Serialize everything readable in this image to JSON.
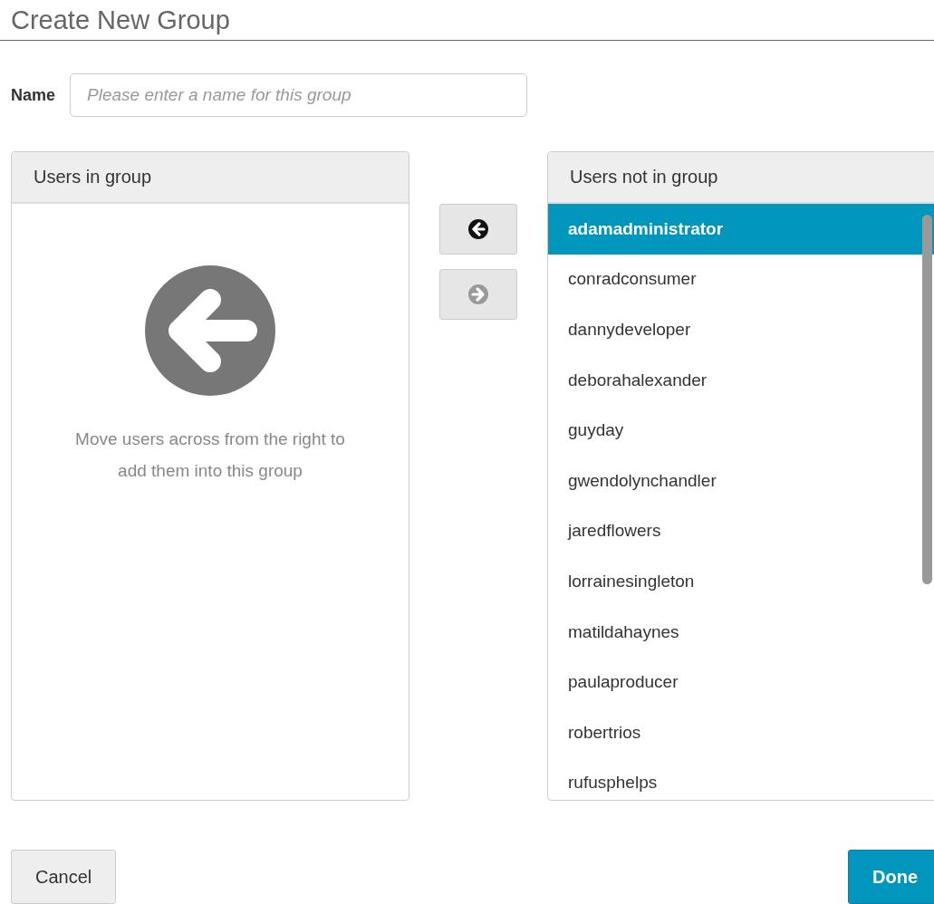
{
  "title": "Create New Group",
  "name_field": {
    "label": "Name",
    "placeholder": "Please enter a name for this group"
  },
  "users_in_group": {
    "header": "Users in group",
    "empty_message": "Move users across from the right to add them into this group"
  },
  "transfer_buttons": [
    {
      "kind": "left",
      "disabled": false
    },
    {
      "kind": "right",
      "disabled": true
    }
  ],
  "users_not_in_group": {
    "header": "Users not in group",
    "users": [
      {
        "name": "adamadministrator",
        "selected": true
      },
      {
        "name": "conradconsumer",
        "selected": false
      },
      {
        "name": "dannydeveloper",
        "selected": false
      },
      {
        "name": "deborahalexander",
        "selected": false
      },
      {
        "name": "guyday",
        "selected": false
      },
      {
        "name": "gwendolynchandler",
        "selected": false
      },
      {
        "name": "jaredflowers",
        "selected": false
      },
      {
        "name": "lorrainesingleton",
        "selected": false
      },
      {
        "name": "matildahaynes",
        "selected": false
      },
      {
        "name": "paulaproducer",
        "selected": false
      },
      {
        "name": "robertrios",
        "selected": false
      },
      {
        "name": "rufusphelps",
        "selected": false
      }
    ]
  },
  "buttons": [
    {
      "kind": "secondary",
      "label": "Cancel"
    },
    {
      "kind": "primary",
      "label": "Done"
    }
  ]
}
